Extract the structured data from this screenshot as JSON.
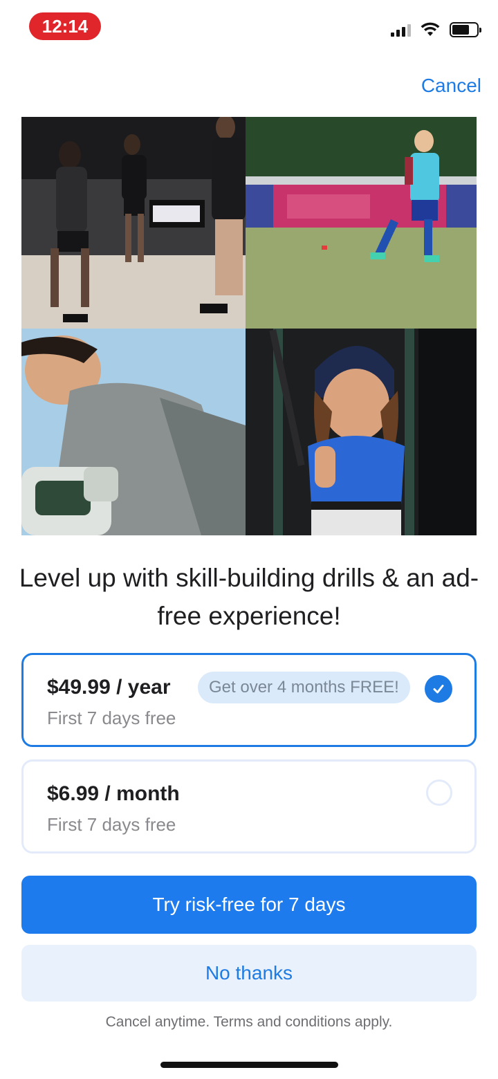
{
  "status_bar": {
    "time": "12:14",
    "icons": [
      "cellular-signal-icon",
      "wifi-icon",
      "battery-icon"
    ],
    "time_pill_color": "#e0262a"
  },
  "header": {
    "cancel_label": "Cancel"
  },
  "photos": [
    {
      "name": "basketball-training-photo"
    },
    {
      "name": "soccer-kid-photo"
    },
    {
      "name": "lacrosse-player-photo"
    },
    {
      "name": "softball-girl-photo"
    }
  ],
  "headline": "Level up with skill-building drills & an ad-free experience!",
  "plans": [
    {
      "price": "$49.99 / year",
      "subtitle": "First 7 days free",
      "badge": "Get over 4 months FREE!",
      "selected": true
    },
    {
      "price": "$6.99 / month",
      "subtitle": "First 7 days free",
      "selected": false
    }
  ],
  "buttons": {
    "primary": "Try risk-free for 7 days",
    "secondary": "No thanks"
  },
  "footnote": "Cancel anytime. Terms and conditions apply.",
  "colors": {
    "accent": "#1d7be3",
    "primary_button": "#1e7bed",
    "secondary_button": "#e9f1fc",
    "badge_bg": "#dbeafa"
  }
}
